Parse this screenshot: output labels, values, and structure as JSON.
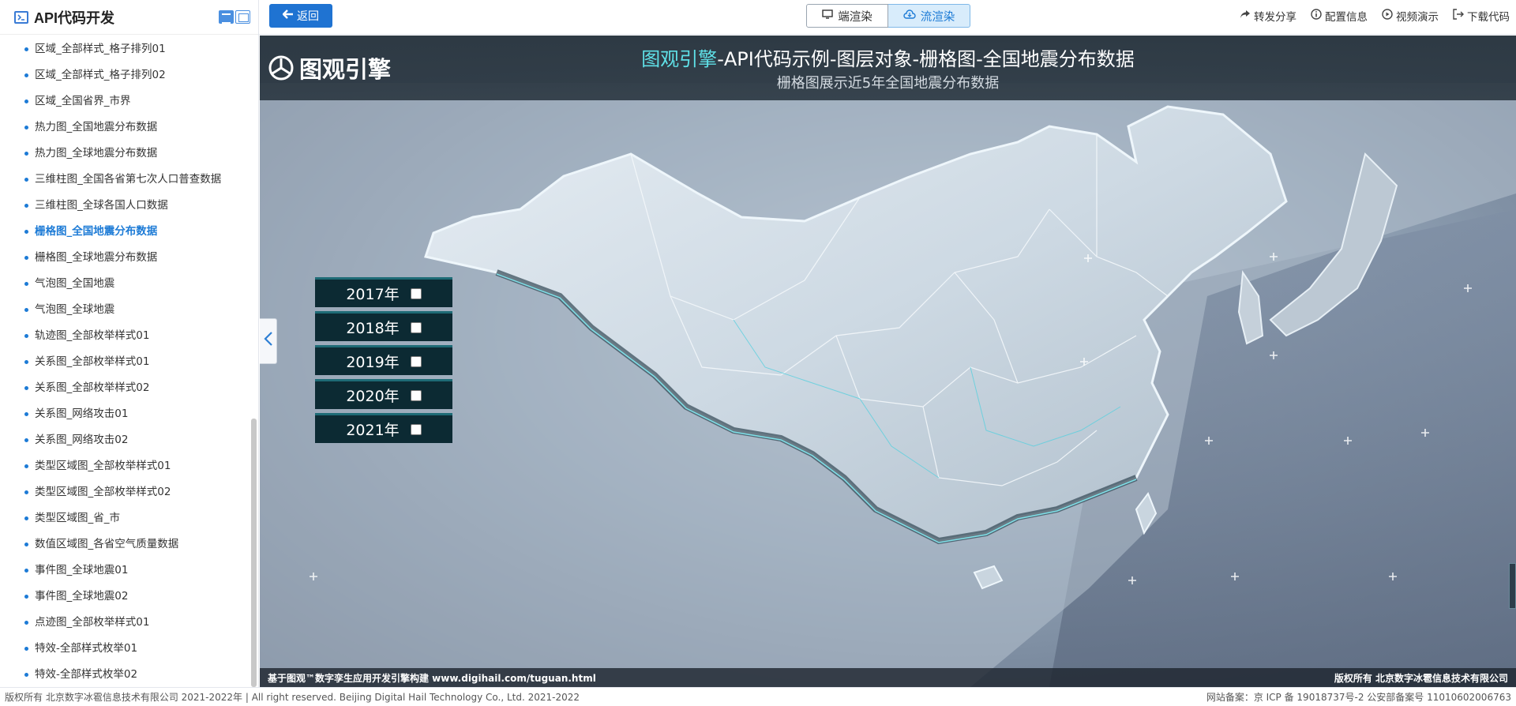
{
  "sidebar": {
    "title": "API代码开发",
    "items": [
      {
        "label": "区域_全部样式_格子排列01"
      },
      {
        "label": "区域_全部样式_格子排列02"
      },
      {
        "label": "区域_全国省界_市界"
      },
      {
        "label": "热力图_全国地震分布数据"
      },
      {
        "label": "热力图_全球地震分布数据"
      },
      {
        "label": "三维柱图_全国各省第七次人口普查数据"
      },
      {
        "label": "三维柱图_全球各国人口数据"
      },
      {
        "label": "栅格图_全国地震分布数据",
        "active": true
      },
      {
        "label": "栅格图_全球地震分布数据"
      },
      {
        "label": "气泡图_全国地震"
      },
      {
        "label": "气泡图_全球地震"
      },
      {
        "label": "轨迹图_全部枚举样式01"
      },
      {
        "label": "关系图_全部枚举样式01"
      },
      {
        "label": "关系图_全部枚举样式02"
      },
      {
        "label": "关系图_网络攻击01"
      },
      {
        "label": "关系图_网络攻击02"
      },
      {
        "label": "类型区域图_全部枚举样式01"
      },
      {
        "label": "类型区域图_全部枚举样式02"
      },
      {
        "label": "类型区域图_省_市"
      },
      {
        "label": "数值区域图_各省空气质量数据"
      },
      {
        "label": "事件图_全球地震01"
      },
      {
        "label": "事件图_全球地震02"
      },
      {
        "label": "点迹图_全部枚举样式01"
      },
      {
        "label": "特效-全部样式枚举01"
      },
      {
        "label": "特效-全部样式枚举02"
      }
    ]
  },
  "toolbar": {
    "back_label": "返回",
    "render_client_label": "端渲染",
    "render_stream_label": "流渲染",
    "share_label": "转发分享",
    "config_label": "配置信息",
    "video_label": "视频演示",
    "download_label": "下载代码"
  },
  "stage": {
    "logo_text": "图观引擎",
    "title_highlight": "图观引擎",
    "title_rest": "-API代码示例-图层对象-栅格图-全国地震分布数据",
    "subtitle": "栅格图展示近5年全国地震分布数据",
    "years": [
      {
        "label": "2017年",
        "checked": false
      },
      {
        "label": "2018年",
        "checked": false
      },
      {
        "label": "2019年",
        "checked": false
      },
      {
        "label": "2020年",
        "checked": false
      },
      {
        "label": "2021年",
        "checked": false
      }
    ],
    "footer_left": "基于图观™数字孪生应用开发引擎构建 www.digihail.com/tuguan.html",
    "footer_right": "版权所有 北京数字冰雹信息技术有限公司"
  },
  "page_footer": {
    "left": "版权所有 北京数字冰雹信息技术有限公司 2021-2022年 | All right reserved. Beijing Digital Hail Technology Co., Ltd. 2021-2022",
    "right": "网站备案：京 ICP 备 19018737号-2 公安部备案号 11010602006763"
  },
  "colors": {
    "accent": "#1d7bd6",
    "title_highlight": "#5fe1e8",
    "year_panel_bg": "#0c2a33"
  }
}
